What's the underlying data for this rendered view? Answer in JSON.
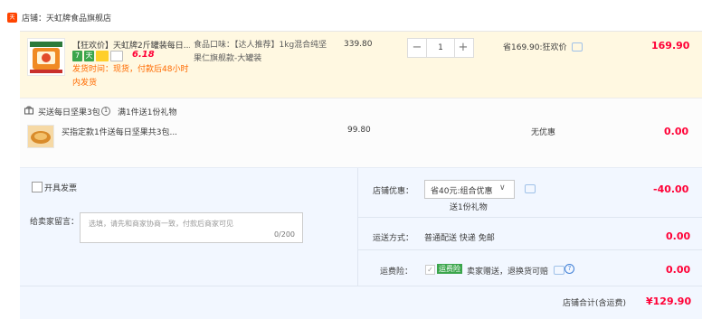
{
  "shop": {
    "badge": "天猫",
    "name_label": "店铺：天虹牌食品旗舰店"
  },
  "item": {
    "title": "【狂欢价】天虹牌2斤罐装每日...",
    "tag1": "7",
    "tag2": "天",
    "promo_badge": "6.18",
    "ship_notice": "发货时间：现货，付款后48小时内发货",
    "props": "食品口味：【达人推荐】1kg混合纯坚果仁旗舰款-大罐装",
    "unit_price": "339.80",
    "quantity": "1",
    "discount_text": "省169.90:狂欢价",
    "subtotal": "169.90"
  },
  "gift": {
    "label": "买送每日坚果3包",
    "note": "满1件送1份礼物",
    "title": "买指定款1件送每日坚果共3包...",
    "price": "99.80",
    "discount": "无优惠",
    "subtotal": "0.00"
  },
  "invoice_label": "开具发票",
  "remark": {
    "label": "给卖家留言：",
    "placeholder": "选填，请先和商家协商一致，付款后商家可见",
    "counter": "0/200"
  },
  "coupon": {
    "label": "店铺优惠：",
    "selected": "省40元:组合优惠",
    "gift_note": "送1份礼物",
    "amount": "-40.00"
  },
  "shipping": {
    "label": "运送方式：",
    "method": "普通配送 快递 免邮",
    "amount": "0.00"
  },
  "insurance": {
    "label": "运费险：",
    "badge": "运费险",
    "text": "卖家赠送，退换货可赔",
    "amount": "0.00"
  },
  "total": {
    "label": "店铺合计(含运费)",
    "amount": "¥129.90"
  },
  "colors": {
    "accent_red": "#ff0036",
    "tmall_red": "#ff4400",
    "orange": "#ff6a00",
    "item_bg": "#fff8e1",
    "lower_bg": "#f2f7ff"
  }
}
